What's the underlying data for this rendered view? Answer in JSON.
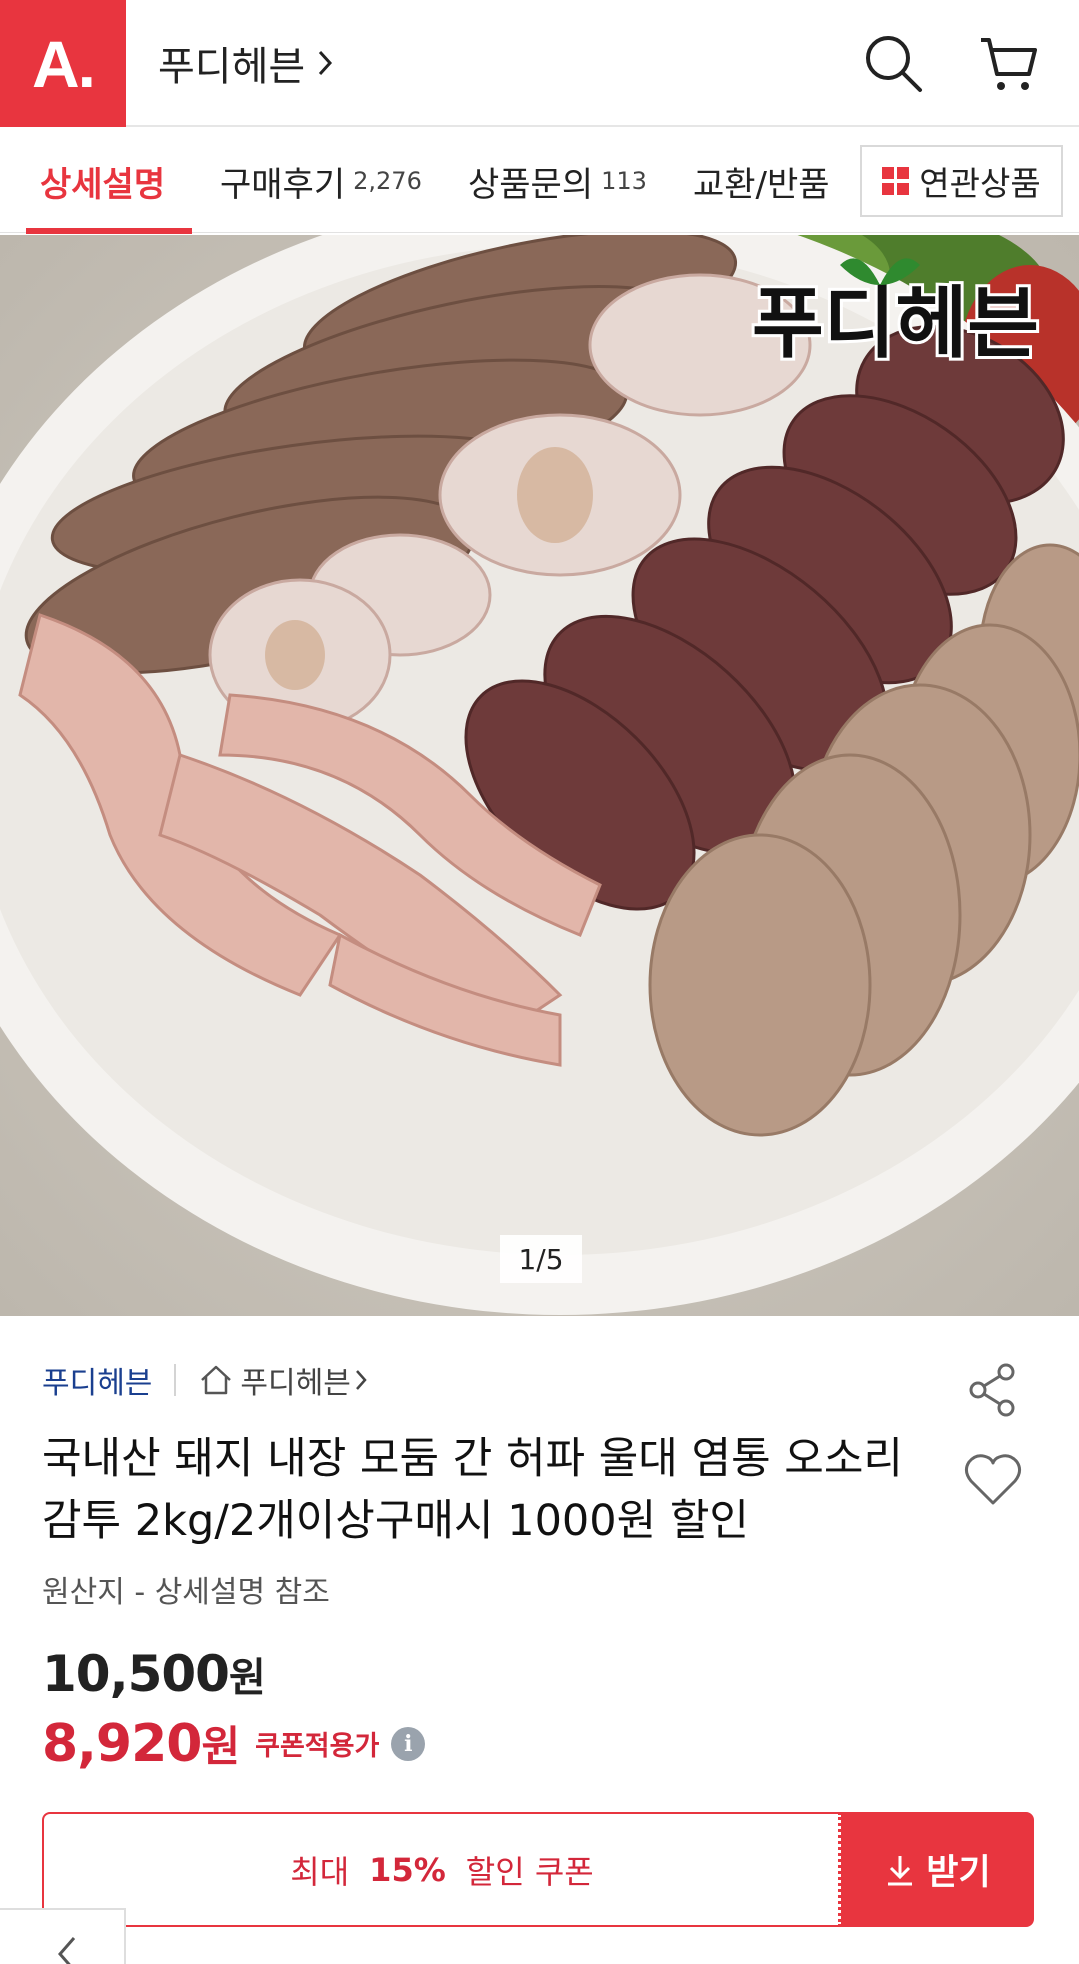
{
  "header": {
    "logo_text": "A.",
    "store_name": "푸디헤븐",
    "store_chevron": "›",
    "brand_color": "#e8353f"
  },
  "tabs": [
    {
      "label": "상세설명",
      "count": "",
      "active": true
    },
    {
      "label": "구매후기",
      "count": "2,276",
      "active": false
    },
    {
      "label": "상품문의",
      "count": "113",
      "active": false
    },
    {
      "label": "교환/반품",
      "count": "",
      "active": false
    }
  ],
  "related_button": {
    "label": "연관상품",
    "icon": "grid-icon"
  },
  "gallery": {
    "counter": "1/5",
    "watermark": "푸디헤븐"
  },
  "product": {
    "brand": "푸디헤븐",
    "store_home": "푸디헤븐",
    "title": "국내산 돼지 내장 모둠 간 허파 울대 염통 오소리감투 2kg/2개이상구매시 1000원 할인",
    "origin": "원산지 - 상세설명 참조",
    "price": "10,500",
    "price_unit": "원",
    "sale_price": "8,920",
    "sale_unit": "원",
    "coupon_note": "쿠폰적용가",
    "info_icon": "i",
    "sale_color": "#d3273a"
  },
  "coupon": {
    "prefix": "최대",
    "percent": "15%",
    "suffix": "할인 쿠폰",
    "button_label": "받기"
  }
}
